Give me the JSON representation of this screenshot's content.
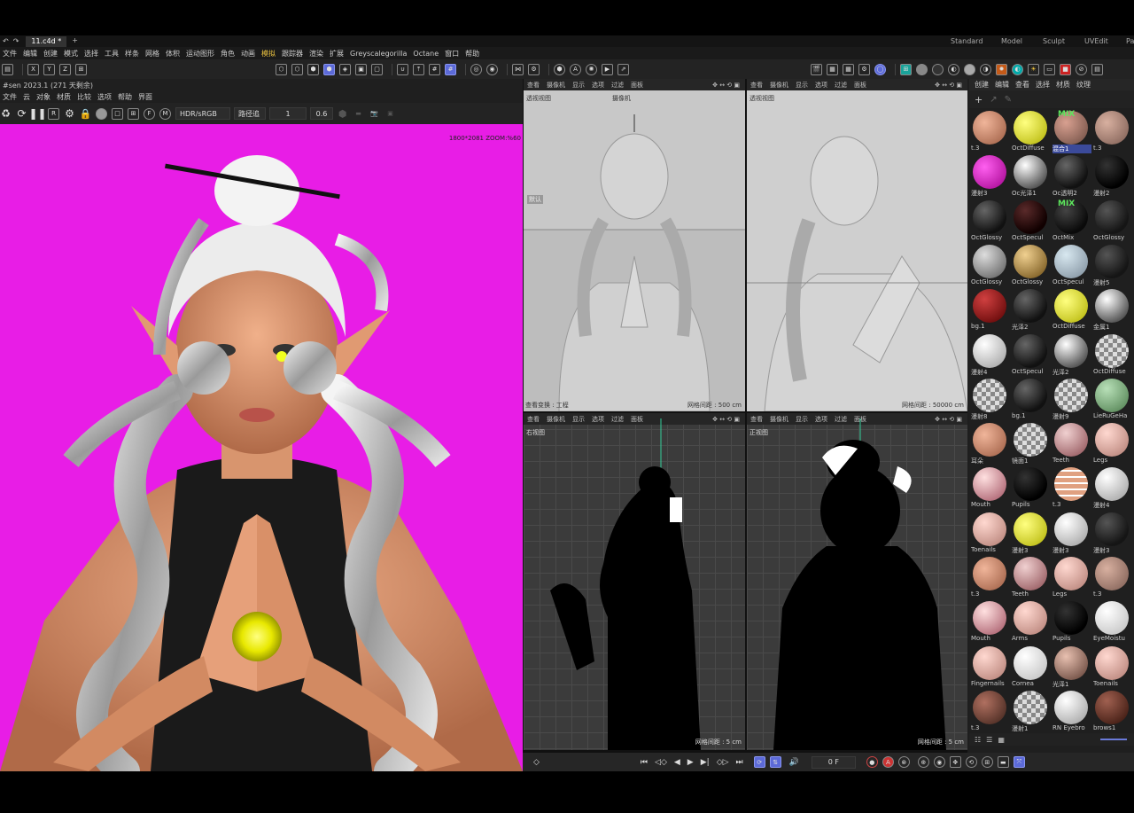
{
  "tabs": [
    {
      "label": "11.c4d *",
      "active": true
    },
    {
      "label": "+",
      "active": false
    }
  ],
  "workspaces": [
    "Standard",
    "Model",
    "Sculpt",
    "UVEdit",
    "Pa"
  ],
  "menu": [
    "文件",
    "编辑",
    "创建",
    "模式",
    "选择",
    "工具",
    "样条",
    "网格",
    "体积",
    "运动图形",
    "角色",
    "动画",
    "模拟",
    "跟踪器",
    "渲染",
    "扩展",
    "Greyscalegorilla",
    "Octane",
    "窗口",
    "帮助"
  ],
  "menu_highlight": "模拟",
  "axis_buttons": [
    "X",
    "Y",
    "Z"
  ],
  "octane": {
    "subtitle": "#sen  2023.1 (271 天剩余)",
    "menu": [
      "文件",
      "云",
      "对象",
      "材质",
      "比较",
      "选项",
      "帮助",
      "界面"
    ],
    "color_mode": "HDR/sRGB",
    "mode_field": "路径追",
    "field1": "1",
    "field2": "0.6",
    "zoom": "1800*2081 ZOOM:%60"
  },
  "viewport_menu": [
    "查看",
    "摄像机",
    "显示",
    "选项",
    "过滤",
    "面板"
  ],
  "viewports": [
    {
      "name": "透视视图",
      "camera": "摄像机",
      "grid": "网格间距 : 500 cm",
      "bottom_left": "查看变换 : 工程",
      "side_label": "默认"
    },
    {
      "name": "透视视图",
      "grid": "网格间距 : 50000 cm"
    },
    {
      "name": "右视图",
      "grid": "网格间距 : 5 cm"
    },
    {
      "name": "正视图",
      "grid": "网格间距 : 5 cm"
    }
  ],
  "materials_menu": [
    "创建",
    "编辑",
    "查看",
    "选择",
    "材质",
    "纹理"
  ],
  "materials": [
    {
      "label": "t.3",
      "style": "skin"
    },
    {
      "label": "OctDiffuse",
      "style": "yellow"
    },
    {
      "label": "混合1",
      "style": "mixskin"
    },
    {
      "label": "t.3",
      "style": "skin2"
    },
    {
      "label": "漫射3",
      "style": "magenta"
    },
    {
      "label": "Oc光泽1",
      "style": "chrome"
    },
    {
      "label": "Oc透明2",
      "style": "dark"
    },
    {
      "label": "漫射2",
      "style": "black"
    },
    {
      "label": "OctGlossy",
      "style": "dark"
    },
    {
      "label": "OctSpecul",
      "style": "darkred"
    },
    {
      "label": "OctMix",
      "style": "mixdark"
    },
    {
      "label": "OctGlossy",
      "style": "dark2"
    },
    {
      "label": "OctGlossy",
      "style": "grey"
    },
    {
      "label": "OctGlossy",
      "style": "gold"
    },
    {
      "label": "OctSpecul",
      "style": "lightblue"
    },
    {
      "label": "漫射5",
      "style": "dark2"
    },
    {
      "label": "bg.1",
      "style": "red"
    },
    {
      "label": "光泽2",
      "style": "dark"
    },
    {
      "label": "OctDiffuse",
      "style": "yellow"
    },
    {
      "label": "金属1",
      "style": "chrome"
    },
    {
      "label": "漫射4",
      "style": "lightgrey"
    },
    {
      "label": "OctSpecul",
      "style": "dark"
    },
    {
      "label": "光泽2",
      "style": "chrome"
    },
    {
      "label": "OctDiffuse",
      "style": "checker"
    },
    {
      "label": "漫射8",
      "style": "checker"
    },
    {
      "label": "bg.1",
      "style": "dark"
    },
    {
      "label": "漫射9",
      "style": "checker"
    },
    {
      "label": "LieRuGeHa",
      "style": "green"
    },
    {
      "label": "耳朵",
      "style": "skin"
    },
    {
      "label": "镜面1",
      "style": "checker"
    },
    {
      "label": "Teeth",
      "style": "teeth"
    },
    {
      "label": "Legs",
      "style": "pinkskin"
    },
    {
      "label": "Mouth",
      "style": "mouth"
    },
    {
      "label": "Pupils",
      "style": "black"
    },
    {
      "label": "t.3",
      "style": "skinstripe"
    },
    {
      "label": "漫射4",
      "style": "lightgrey"
    },
    {
      "label": "Toenails",
      "style": "pinkskin"
    },
    {
      "label": "漫射3",
      "style": "yellow"
    },
    {
      "label": "漫射3",
      "style": "lightgrey"
    },
    {
      "label": "漫射3",
      "style": "dark2"
    },
    {
      "label": "t.3",
      "style": "skin"
    },
    {
      "label": "Teeth",
      "style": "teeth"
    },
    {
      "label": "Legs",
      "style": "pinkskin"
    },
    {
      "label": "t.3",
      "style": "skin2"
    },
    {
      "label": "Mouth",
      "style": "mouth"
    },
    {
      "label": "Arms",
      "style": "pinkskin"
    },
    {
      "label": "Pupils",
      "style": "black"
    },
    {
      "label": "EyeMoistu",
      "style": "white"
    },
    {
      "label": "Fingernails",
      "style": "pinkskin"
    },
    {
      "label": "Cornea",
      "style": "white"
    },
    {
      "label": "光泽1",
      "style": "chromeskin"
    },
    {
      "label": "Toenails",
      "style": "pinkskin"
    },
    {
      "label": "t.3",
      "style": "skindark"
    },
    {
      "label": "漫射1",
      "style": "checker"
    },
    {
      "label": "RN Eyebro",
      "style": "lightgrey"
    },
    {
      "label": "brows1",
      "style": "brown"
    }
  ],
  "timeline": {
    "frame": "0 F"
  }
}
